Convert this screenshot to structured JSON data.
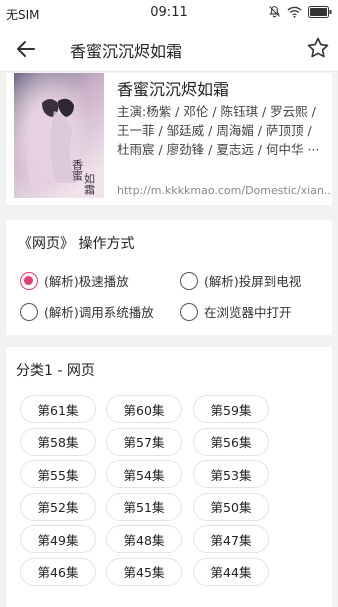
{
  "status": {
    "carrier": "无SIM",
    "time": "09:11"
  },
  "appbar": {
    "title": "香蜜沉沉烬如霜"
  },
  "show": {
    "title": "香蜜沉沉烬如霜",
    "cast_lines": [
      "主演:杨紫 / 邓伦 / 陈钰琪 / 罗云熙 /",
      "王一菲 / 邹廷威 / 周海媚 / 萨顶顶 /",
      "杜雨宸 / 廖劲锋 / 夏志远 / 何中华 ···"
    ],
    "url": "http://m.kkkkmao.com/Domestic/xian..."
  },
  "ops": {
    "heading": "《网页》 操作方式",
    "options": [
      {
        "label": "(解析)极速播放",
        "selected": true
      },
      {
        "label": "(解析)投屏到电视",
        "selected": false
      },
      {
        "label": "(解析)调用系统播放",
        "selected": false
      },
      {
        "label": "在浏览器中打开",
        "selected": false
      }
    ]
  },
  "episodes": {
    "heading": "分类1 - 网页",
    "items": [
      "第61集",
      "第60集",
      "第59集",
      "第58集",
      "第57集",
      "第56集",
      "第55集",
      "第54集",
      "第53集",
      "第52集",
      "第51集",
      "第50集",
      "第49集",
      "第48集",
      "第47集",
      "第46集",
      "第45集",
      "第44集"
    ]
  },
  "colors": {
    "accent": "#e23d78"
  }
}
